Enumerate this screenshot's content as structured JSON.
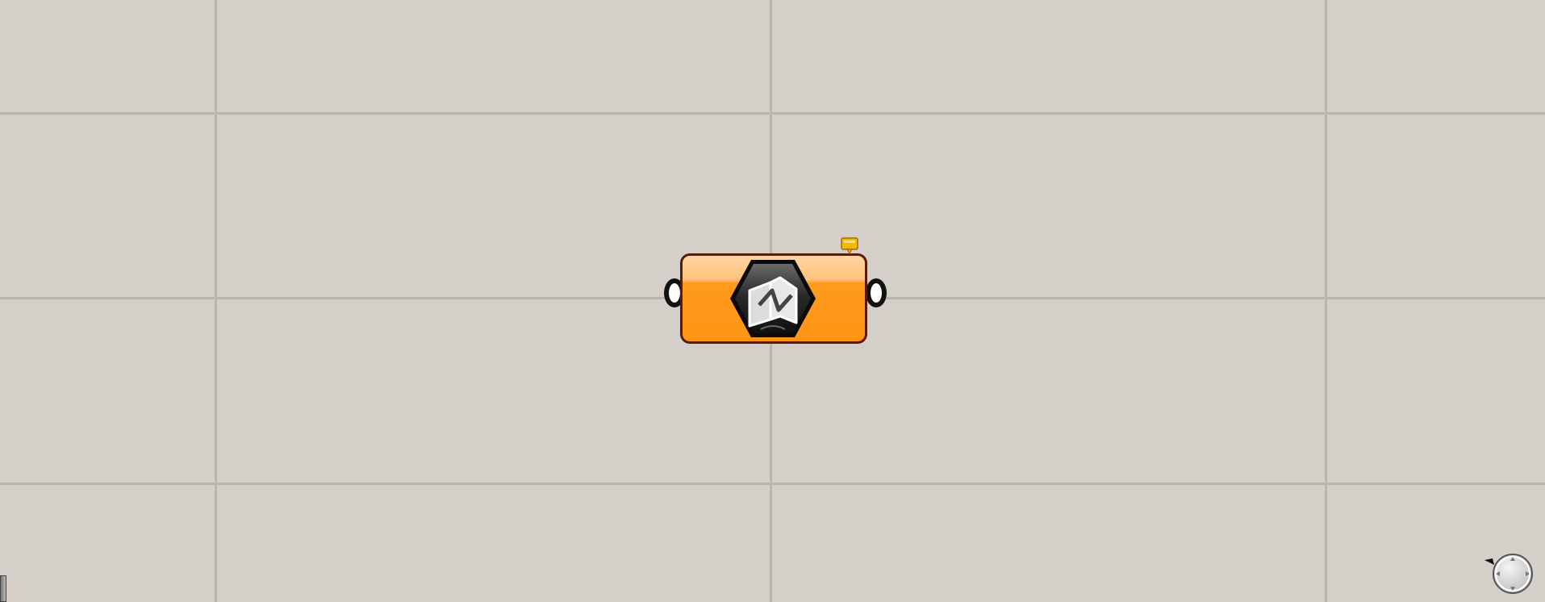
{
  "canvas": {
    "background": "#d4d0c9",
    "grid_color": "#b9b5ae"
  },
  "component": {
    "icon": "map-book-icon",
    "body_color": "#ff9514",
    "outline_color": "#5a1a0a",
    "status": "warning",
    "status_icon": "warning-flag-icon",
    "status_color": "#f5b800"
  },
  "navigation_widget": {
    "icon": "compass-navigator-icon"
  }
}
